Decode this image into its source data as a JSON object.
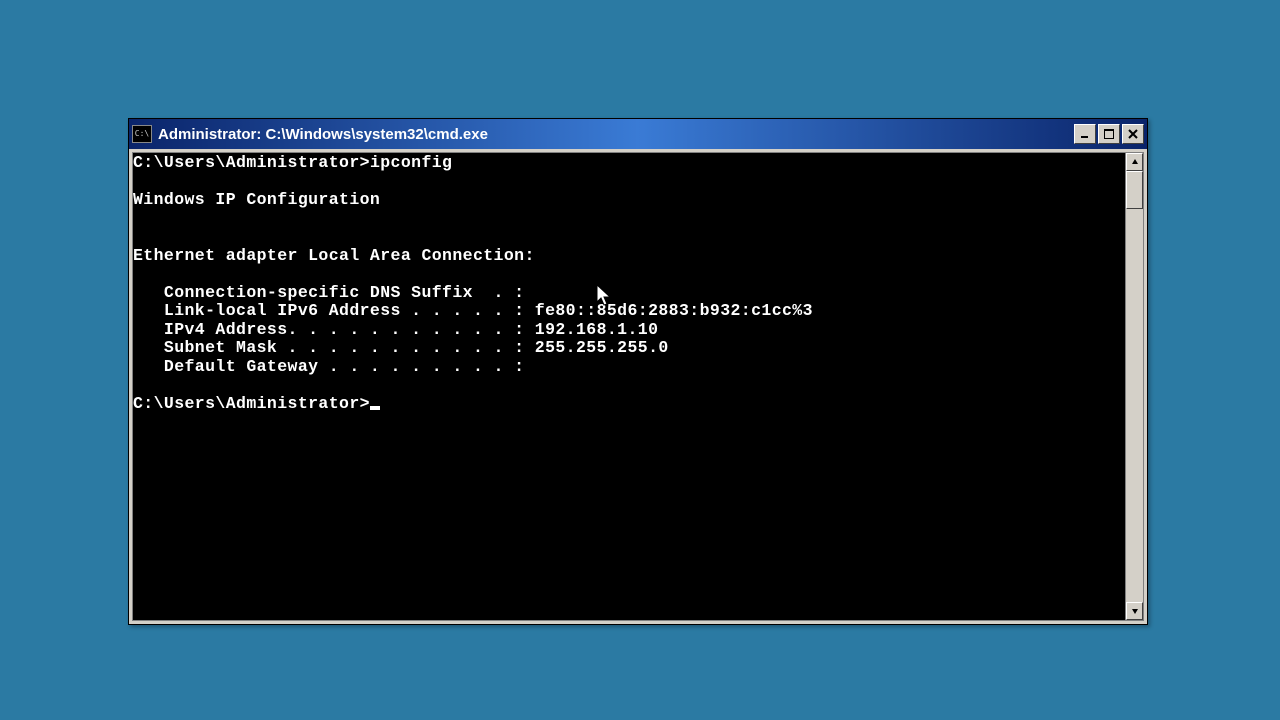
{
  "window": {
    "title": "Administrator: C:\\Windows\\system32\\cmd.exe"
  },
  "console": {
    "prompt1": "C:\\Users\\Administrator>",
    "command1": "ipconfig",
    "blank1": "",
    "header": "Windows IP Configuration",
    "blank2": "",
    "blank3": "",
    "adapter": "Ethernet adapter Local Area Connection:",
    "blank4": "",
    "dns": "   Connection-specific DNS Suffix  . :",
    "ipv6": "   Link-local IPv6 Address . . . . . : fe80::85d6:2883:b932:c1cc%3",
    "ipv4": "   IPv4 Address. . . . . . . . . . . : 192.168.1.10",
    "mask": "   Subnet Mask . . . . . . . . . . . : 255.255.255.0",
    "gw": "   Default Gateway . . . . . . . . . :",
    "blank5": "",
    "prompt2": "C:\\Users\\Administrator>"
  }
}
